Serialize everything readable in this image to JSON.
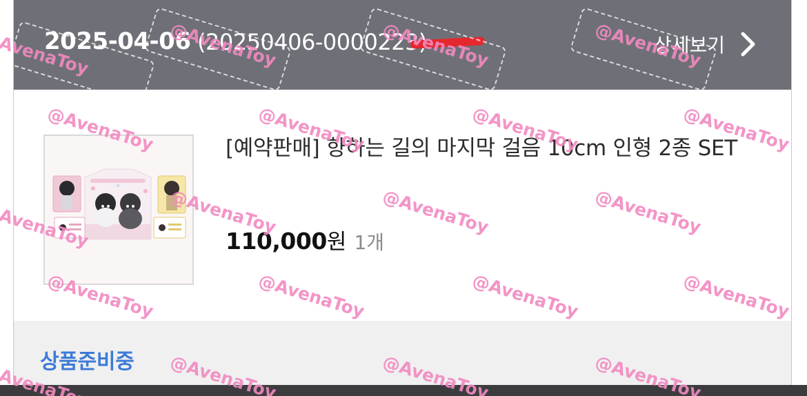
{
  "order": {
    "date": "2025-04-06",
    "number": "(20250406-0000223)",
    "detail_label": "상세보기"
  },
  "product": {
    "title": "[예약판매] 향하는 길의 마지막 걸음 10cm 인형 2종 SET",
    "price": "110,000",
    "currency_unit": "원",
    "quantity": "1개"
  },
  "status": {
    "label": "상품준비중"
  },
  "watermark": {
    "text": "@AvenaToy",
    "color": "#f28ac1"
  },
  "colors": {
    "header_bg": "#6f7077",
    "status_text": "#3d7bd7",
    "status_bg": "#f0f0f1",
    "redaction": "#e5282e"
  },
  "icons": {
    "detail_chevron": "chevron-right-icon"
  }
}
